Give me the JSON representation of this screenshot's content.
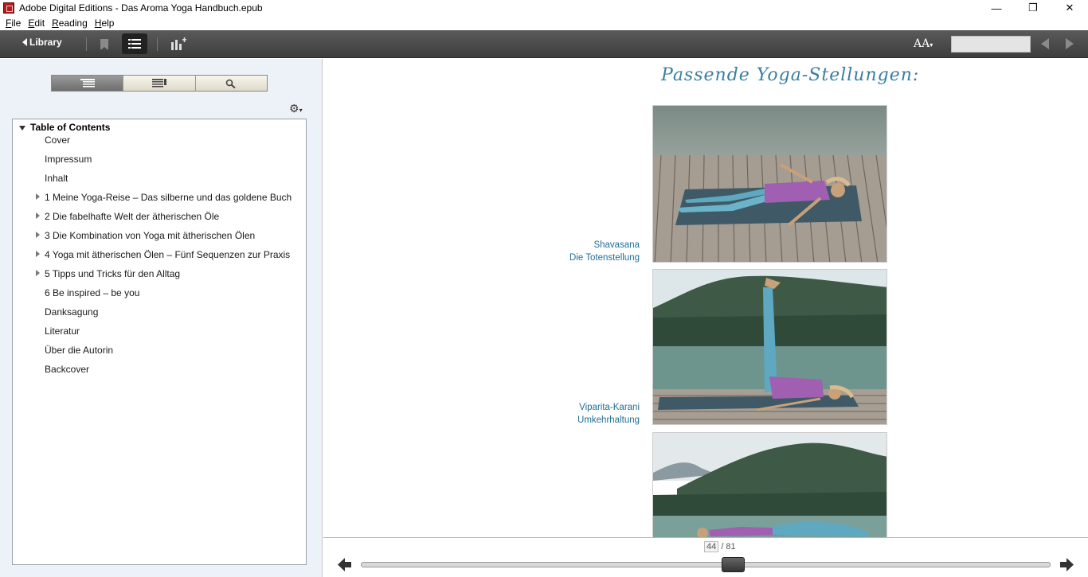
{
  "window": {
    "title": "Adobe Digital Editions - Das Aroma Yoga Handbuch.epub",
    "minimize": "—",
    "restore": "❐",
    "close": "✕"
  },
  "menu": {
    "items": [
      {
        "mnemonic": "F",
        "rest": "ile"
      },
      {
        "mnemonic": "E",
        "rest": "dit"
      },
      {
        "mnemonic": "R",
        "rest": "eading"
      },
      {
        "mnemonic": "H",
        "rest": "elp"
      }
    ]
  },
  "toolbar": {
    "library_label": "Library",
    "font_label": "AA",
    "page_input_value": ""
  },
  "sidebar": {
    "tabs": [
      "toc-tab",
      "bookmarks-tab",
      "search-tab"
    ],
    "active_tab": 0,
    "toc_title": "Table of Contents",
    "toc_items": [
      {
        "label": "Cover",
        "expandable": false
      },
      {
        "label": "Impressum",
        "expandable": false
      },
      {
        "label": "Inhalt",
        "expandable": false
      },
      {
        "label": "1 Meine Yoga-Reise – Das silberne und das goldene Buch",
        "expandable": true
      },
      {
        "label": "2 Die fabelhafte Welt der ätherischen Öle",
        "expandable": true
      },
      {
        "label": "3 Die Kombination von Yoga mit ätherischen Ölen",
        "expandable": true
      },
      {
        "label": "4 Yoga mit ätherischen Ölen – Fünf Sequenzen zur Praxis",
        "expandable": true
      },
      {
        "label": "5 Tipps und Tricks für den Alltag",
        "expandable": true
      },
      {
        "label": "6 Be inspired – be you",
        "expandable": false
      },
      {
        "label": "Danksagung",
        "expandable": false
      },
      {
        "label": "Literatur",
        "expandable": false
      },
      {
        "label": "Über die Autorin",
        "expandable": false
      },
      {
        "label": "Backcover",
        "expandable": false
      }
    ]
  },
  "page": {
    "heading": "Passende Yoga-Stellungen:",
    "poses": [
      {
        "name": "Shavasana",
        "subtitle": "Die Totenstellung"
      },
      {
        "name": "Viparita-Karani",
        "subtitle": "Umkehrhaltung"
      }
    ]
  },
  "footer": {
    "current_page": "44",
    "total_pages": "/ 81",
    "progress": 0.54
  },
  "colors": {
    "toolbar": "#4a4a4a",
    "sidebar_bg": "#edf1f8",
    "caption": "#1f6e95",
    "heading": "#3a7fa0"
  }
}
